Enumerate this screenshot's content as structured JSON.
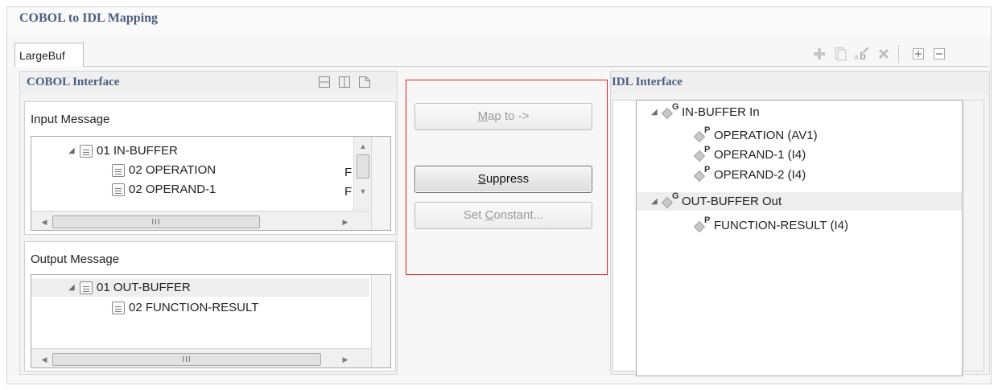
{
  "title": "COBOL to IDL Mapping",
  "tab": {
    "label": "LargeBuf"
  },
  "toolbar": {
    "add_icon": "plus-icon",
    "copy_icon": "copy-icon",
    "rename_icon": "rename-icon",
    "delete_icon": "delete-icon",
    "expand_icon": "expand-all-icon",
    "collapse_icon": "collapse-all-icon"
  },
  "cobol_panel": {
    "title": "COBOL Interface",
    "input": {
      "title": "Input Message",
      "items": [
        {
          "label": "01 IN-BUFFER",
          "suffix": ""
        },
        {
          "label": "02 OPERATION",
          "suffix": "F"
        },
        {
          "label": "02 OPERAND-1",
          "suffix": "F"
        }
      ],
      "scroll_glyph": "III"
    },
    "output": {
      "title": "Output Message",
      "items": [
        {
          "label": "01 OUT-BUFFER"
        },
        {
          "label": "02 FUNCTION-RESULT"
        }
      ],
      "scroll_glyph": "III"
    }
  },
  "actions": {
    "map_to": {
      "pre": "",
      "key": "M",
      "post": "ap to ->"
    },
    "suppress": {
      "pre": "",
      "key": "S",
      "post": "uppress"
    },
    "set_constant": {
      "pre": "Set ",
      "key": "C",
      "post": "onstant..."
    }
  },
  "idl_panel": {
    "title": "IDL Interface",
    "items": [
      {
        "badge": "G",
        "label": "IN-BUFFER  In"
      },
      {
        "badge": "P",
        "label": "OPERATION  (AV1)"
      },
      {
        "badge": "P",
        "label": "OPERAND-1  (I4)"
      },
      {
        "badge": "P",
        "label": "OPERAND-2  (I4)"
      },
      {
        "badge": "G",
        "label": "OUT-BUFFER  Out"
      },
      {
        "badge": "P",
        "label": "FUNCTION-RESULT  (I4)"
      }
    ]
  },
  "colors": {
    "heading": "#4a5f7f",
    "highlight_border": "#e02020"
  }
}
